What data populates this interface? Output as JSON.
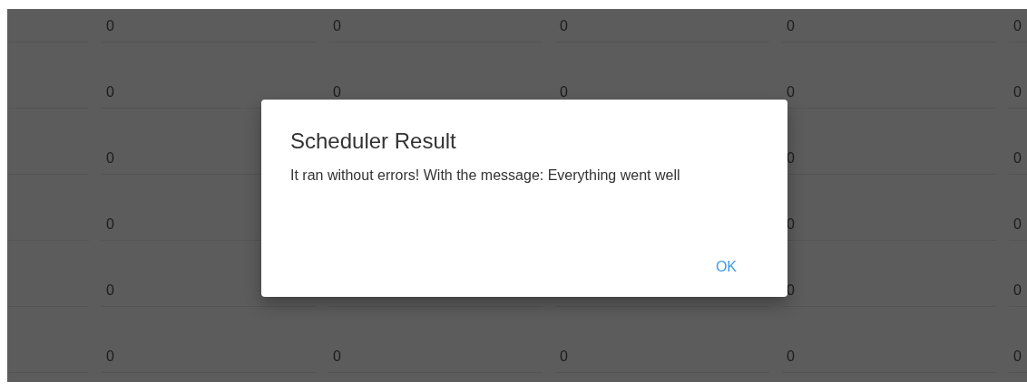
{
  "table": {
    "rows": [
      {
        "column_1": "0",
        "column_2": "0",
        "column_3": "0",
        "column_4": "0",
        "column_5": "0"
      },
      {
        "column_1": "0",
        "column_2": "0",
        "column_3": "0",
        "column_4": "0",
        "column_5": "0"
      },
      {
        "column_1": "0",
        "column_4": "0",
        "column_5": "0"
      },
      {
        "column_1": "0",
        "column_4": "0",
        "column_5": "0"
      },
      {
        "column_1": "0",
        "column_4": "0",
        "column_5": "0"
      },
      {
        "column_1": "0",
        "column_2": "0",
        "column_3": "0",
        "column_4": "0",
        "column_5": "0"
      }
    ]
  },
  "dialog": {
    "title": "Scheduler Result",
    "message": "It ran without errors! With the message: Everything went well",
    "buttons": [
      "OK"
    ]
  }
}
